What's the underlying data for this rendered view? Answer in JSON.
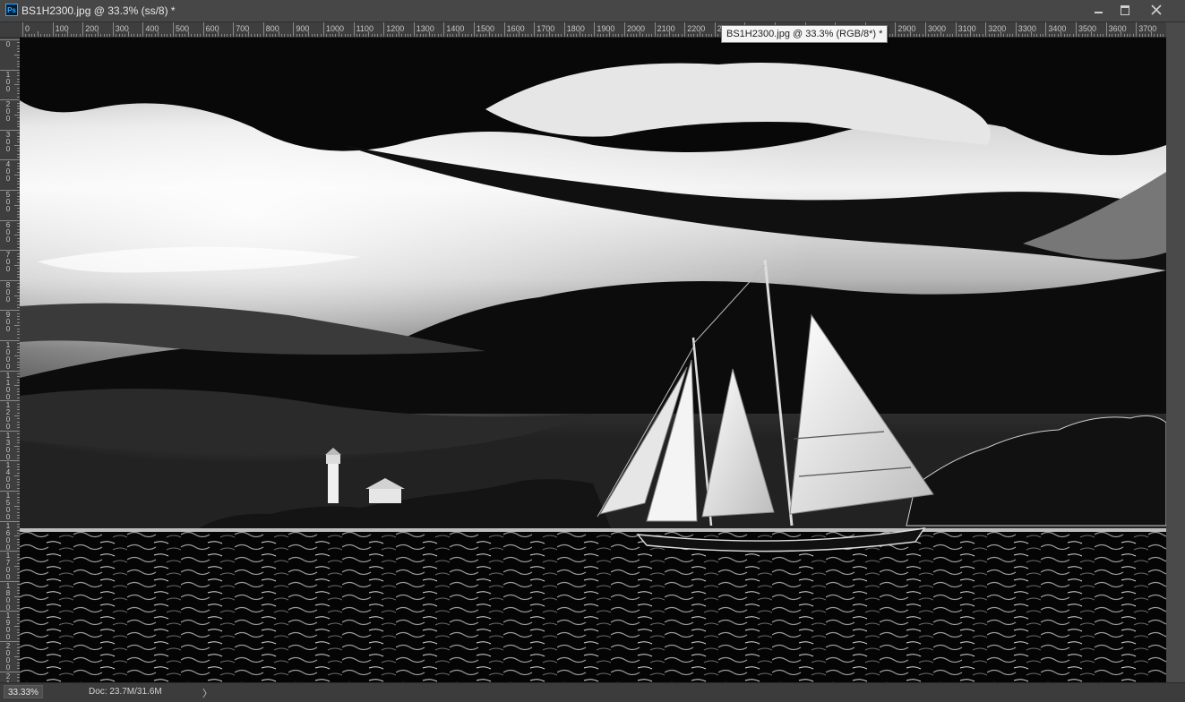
{
  "app": {
    "icon_label": "Ps"
  },
  "document": {
    "title": "BS1H2300.jpg @ 33.3% (ss/8) *"
  },
  "tooltip": {
    "text": "BS1H2300.jpg @ 33.3% (RGB/8*) *"
  },
  "rulers": {
    "horizontal_labels": [
      "0",
      "100",
      "200",
      "300",
      "400",
      "500",
      "600",
      "700",
      "800",
      "900",
      "1000",
      "1100",
      "1200",
      "1300",
      "1400",
      "1500",
      "1600",
      "1700",
      "1800",
      "1900",
      "2000",
      "2100",
      "2200",
      "2300",
      "2400",
      "2500",
      "2600",
      "2700",
      "2800",
      "2900",
      "3000",
      "3100",
      "3200",
      "3300",
      "3400",
      "3500",
      "3600",
      "3700",
      "38"
    ],
    "vertical_labels": [
      "0",
      "100",
      "200",
      "300",
      "400",
      "500",
      "600",
      "700",
      "800",
      "900",
      "1000",
      "1100",
      "1200",
      "1300",
      "1400",
      "1500",
      "1600",
      "1700",
      "1800",
      "1900",
      "2000",
      "2100"
    ]
  },
  "status": {
    "zoom": "33.33%",
    "doc_info": "Doc: 23.7M/31.6M",
    "arrow": "〉"
  },
  "colors": {
    "panel": "#535353",
    "titlebar": "#474747",
    "ruler": "#3e3e3e",
    "ps_blue": "#31a8ff"
  }
}
